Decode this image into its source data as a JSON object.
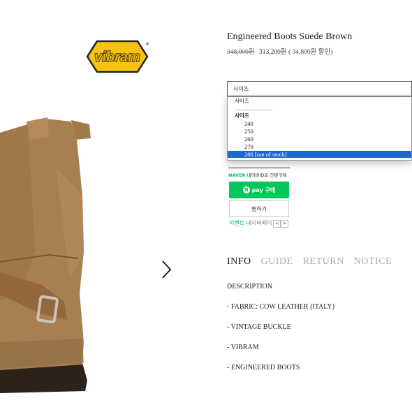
{
  "logo": {
    "text": "vibram",
    "mark": "®"
  },
  "icons": {
    "next": "chevron-right-icon",
    "npay": "naver-n-icon"
  },
  "colors": {
    "naver_green": "#03c75a",
    "selected_option": "#1e66d0"
  },
  "product": {
    "title": "Engineered Boots Suede Brown",
    "original_price": "348,000원",
    "sale_price": "313,200원",
    "discount": "( 34,800원 할인)"
  },
  "size_select": {
    "current": "사이즈",
    "dropdown": {
      "header": "사이즈",
      "separator": "-------------------",
      "group": "사이즈",
      "options": [
        "240",
        "250",
        "260",
        "270",
        "280 [out of stock]"
      ],
      "selected_index": 4
    }
  },
  "naver": {
    "brand": "NAVER",
    "checkout_text": "네이버ID로 간편구매",
    "pay_label": "pay 구매",
    "wish_label": "찜하기",
    "event_highlight": "이벤트",
    "event_text": " 네이버페이",
    "prev": "<",
    "next": ">"
  },
  "tabs": [
    "INFO",
    "GUIDE",
    "RETURN",
    "NOTICE"
  ],
  "active_tab": 0,
  "description": {
    "heading": "DESCRIPTION",
    "lines": [
      "- FABRIC: COW LEATHER (ITALY)",
      "- VINTAGE BUCKLE",
      "- VIBRAM",
      "- ENGINEERED BOOTS"
    ]
  }
}
